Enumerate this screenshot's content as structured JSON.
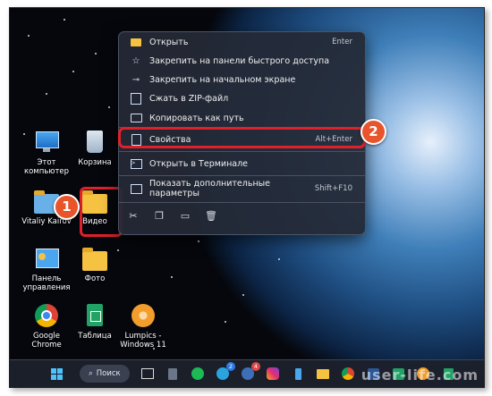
{
  "desktop": {
    "icons": [
      {
        "label": "Этот компьютер",
        "icon": "computer-icon"
      },
      {
        "label": "Корзина",
        "icon": "recycle-bin-icon"
      },
      {
        "label": "Vitaliy Kairov",
        "icon": "user-folder-icon"
      },
      {
        "label": "Видео",
        "icon": "folder-icon"
      },
      {
        "label": "Панель управления",
        "icon": "control-panel-icon"
      },
      {
        "label": "Фото",
        "icon": "folder-icon"
      },
      {
        "label": "Google Chrome",
        "icon": "chrome-icon"
      },
      {
        "label": "Таблица",
        "icon": "spreadsheet-icon"
      },
      {
        "label": "Lumpics - Windows 11",
        "icon": "lumpics-icon"
      }
    ]
  },
  "context_menu": {
    "items": [
      {
        "label": "Открыть",
        "shortcut": "Enter",
        "icon": "folder-open-icon"
      },
      {
        "label": "Закрепить на панели быстрого доступа",
        "shortcut": "",
        "icon": "pin-star-icon"
      },
      {
        "label": "Закрепить на начальном экране",
        "shortcut": "",
        "icon": "pin-icon"
      },
      {
        "label": "Сжать в ZIP-файл",
        "shortcut": "",
        "icon": "zip-icon"
      },
      {
        "label": "Копировать как путь",
        "shortcut": "",
        "icon": "copy-path-icon"
      },
      {
        "label": "Свойства",
        "shortcut": "Alt+Enter",
        "icon": "properties-icon"
      },
      {
        "label": "Открыть в Терминале",
        "shortcut": "",
        "icon": "terminal-icon"
      },
      {
        "label": "Показать дополнительные параметры",
        "shortcut": "Shift+F10",
        "icon": "more-options-icon"
      }
    ],
    "actions": [
      "cut-icon",
      "copy-icon",
      "rename-icon",
      "delete-icon"
    ]
  },
  "annotations": {
    "step1": "1",
    "step2": "2",
    "highlight_color": "#e0202a",
    "badge_color": "#e8542c"
  },
  "taskbar": {
    "search_label": "Поиск",
    "telegram_badge": "2",
    "notify_badge": "4"
  },
  "watermark": "user-life.com"
}
